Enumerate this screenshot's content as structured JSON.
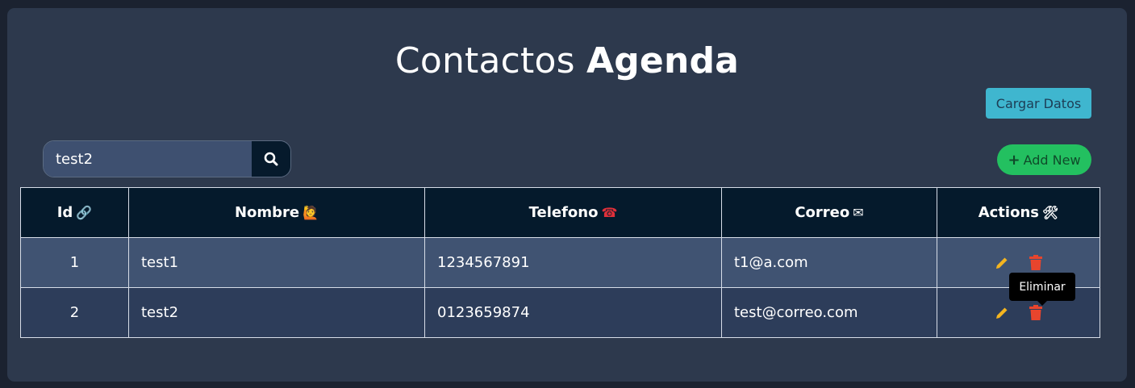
{
  "header": {
    "title_light": "Contactos",
    "title_bold": "Agenda"
  },
  "toolbar": {
    "load_label": "Cargar Datos",
    "add_label": "Add New",
    "add_icon": "plus-icon"
  },
  "search": {
    "value": "test2",
    "placeholder": "",
    "button_icon": "search-icon"
  },
  "table": {
    "columns": [
      {
        "label": "Id",
        "emoji": "🔗"
      },
      {
        "label": "Nombre",
        "emoji": "🙋"
      },
      {
        "label": "Telefono",
        "emoji": "☎"
      },
      {
        "label": "Correo",
        "emoji": "✉"
      },
      {
        "label": "Actions",
        "emoji": "🛠"
      }
    ],
    "rows": [
      {
        "id": "1",
        "nombre": "test1",
        "telefono": "1234567891",
        "correo": "t1@a.com"
      },
      {
        "id": "2",
        "nombre": "test2",
        "telefono": "0123659874",
        "correo": "test@correo.com"
      }
    ],
    "actions": {
      "edit_icon": "pencil-icon",
      "delete_icon": "trash-icon"
    }
  },
  "tooltip": {
    "text": "Eliminar"
  },
  "colors": {
    "background": "#1b2230",
    "card": "#2d394d",
    "header_row": "#051a2c",
    "row_odd": "#405372",
    "row_even": "#2d3d5a",
    "load_button": "#3fb6cf",
    "add_button": "#23c060",
    "edit_icon": "#f5b51f",
    "delete_icon": "#e8452d"
  }
}
